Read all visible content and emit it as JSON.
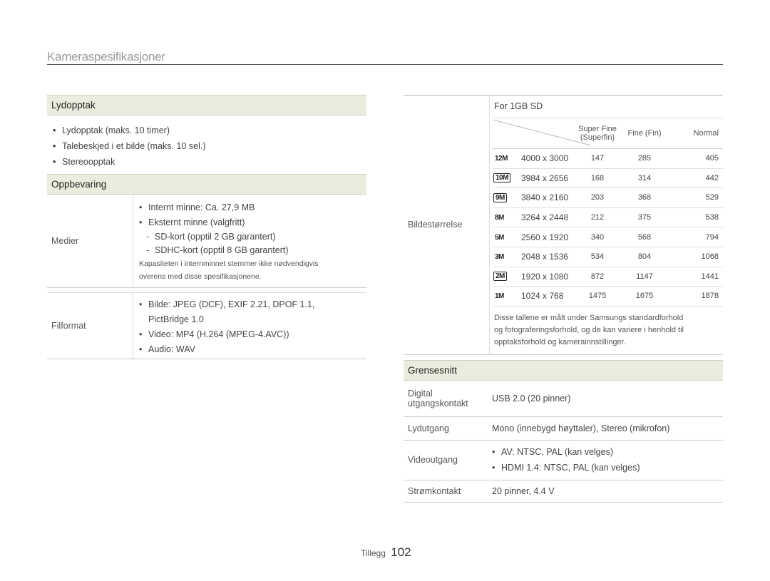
{
  "header": {
    "title": "Kameraspesifikasjoner"
  },
  "left": {
    "lydopptak": {
      "title": "Lydopptak",
      "items": [
        "Lydopptak (maks. 10 timer)",
        "Talebeskjed i et bilde (maks. 10 sel.)",
        "Stereoopptak"
      ]
    },
    "oppbevaring": {
      "title": "Oppbevaring",
      "medier": {
        "label": "Medier",
        "bullets": [
          "Internt minne: Ca. 27,9 MB",
          "Eksternt minne (valgfritt)"
        ],
        "dashes": [
          "SD-kort (opptil 2 GB garantert)",
          "SDHC-kort (opptil 8 GB garantert)"
        ],
        "note_line1": "Kapasiteten i internminnet stemmer ikke nødvendigvis",
        "note_line2": "overens med disse spesifikasjonene."
      },
      "filformat": {
        "label": "Filformat",
        "bullet1": "Bilde: JPEG (DCF), EXIF 2.21, DPOF 1.1,",
        "bullet1_cont": "PictBridge 1.0",
        "bullet2": "Video: MP4 (H.264 (MPEG-4.AVC))",
        "bullet3": "Audio: WAV"
      }
    }
  },
  "right": {
    "bildestorrelse": {
      "label": "Bildestørrelse",
      "capacity_heading": "For 1GB SD",
      "columns": {
        "superfine": "Super Fine",
        "superfine_sub": "(Superfin)",
        "fine": "Fine (Fin)",
        "normal": "Normal"
      },
      "rows": [
        {
          "icon": "12M",
          "dim": "4000 x 3000",
          "sf": "147",
          "f": "285",
          "n": "405"
        },
        {
          "icon": "10M",
          "dim": "3984 x 2656",
          "sf": "168",
          "f": "314",
          "n": "442"
        },
        {
          "icon": "9M",
          "dim": "3840 x 2160",
          "sf": "203",
          "f": "368",
          "n": "529"
        },
        {
          "icon": "8M",
          "dim": "3264 x 2448",
          "sf": "212",
          "f": "375",
          "n": "538"
        },
        {
          "icon": "5M",
          "dim": "2560 x 1920",
          "sf": "340",
          "f": "568",
          "n": "794"
        },
        {
          "icon": "3M",
          "dim": "2048 x 1536",
          "sf": "534",
          "f": "804",
          "n": "1068"
        },
        {
          "icon": "2M",
          "dim": "1920 x 1080",
          "sf": "872",
          "f": "1147",
          "n": "1441"
        },
        {
          "icon": "1M",
          "dim": "1024 x 768",
          "sf": "1475",
          "f": "1675",
          "n": "1878"
        }
      ],
      "note_line1": "Disse tallene er målt under Samsungs standardforhold",
      "note_line2": "og fotograferingsforhold, og de kan variere i henhold til",
      "note_line3": "opptaksforhold og kamerainnstillinger."
    },
    "grensesnitt": {
      "title": "Grensesnitt",
      "digital": {
        "label_line1": "Digital",
        "label_line2": "utgangskontakt",
        "value": "USB 2.0 (20 pinner)"
      },
      "lydutgang": {
        "label": "Lydutgang",
        "value": "Mono (innebygd høyttaler), Stereo (mikrofon)"
      },
      "videoutgang": {
        "label": "Videoutgang",
        "bullet1": "AV: NTSC, PAL (kan velges)",
        "bullet2": "HDMI 1.4: NTSC, PAL (kan velges)"
      },
      "stromkontakt": {
        "label": "Strømkontakt",
        "value": "20 pinner, 4.4 V"
      }
    }
  },
  "footer": {
    "section": "Tillegg",
    "page": "102"
  }
}
